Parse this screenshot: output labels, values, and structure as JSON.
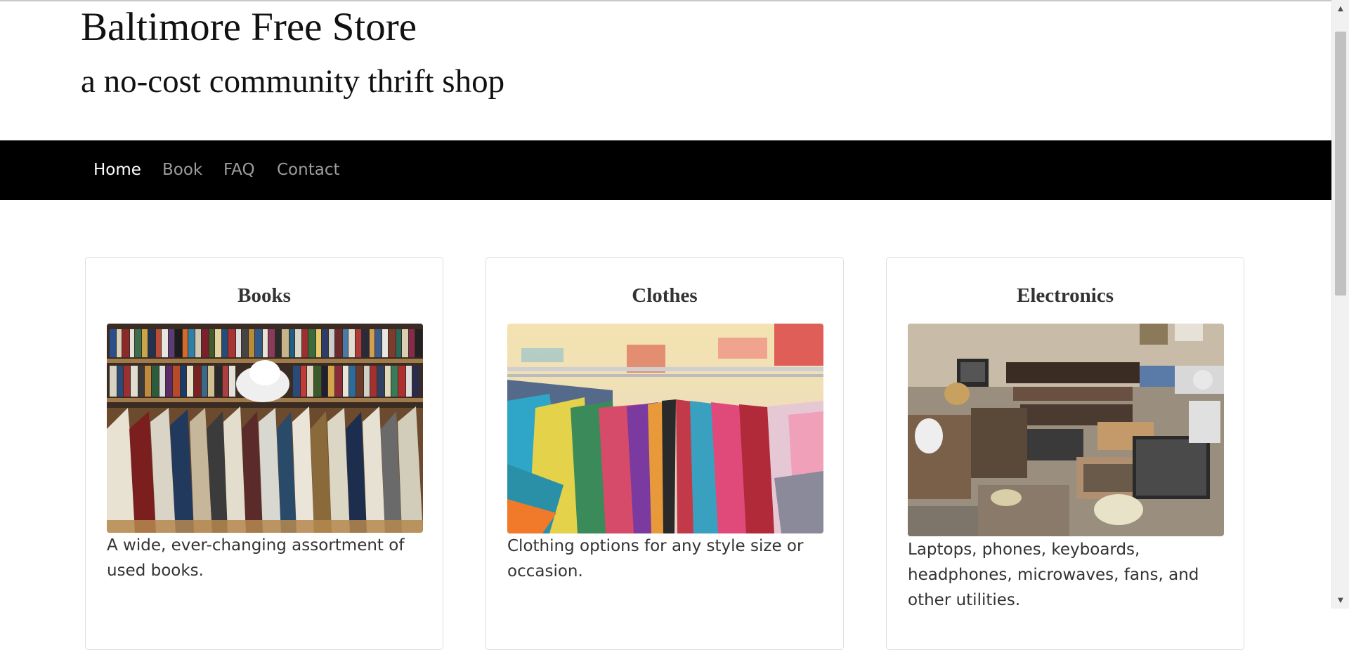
{
  "header": {
    "title": "Baltimore Free Store",
    "subtitle": "a no-cost community thrift shop"
  },
  "nav": {
    "items": [
      {
        "label": "Home",
        "active": true
      },
      {
        "label": "Book",
        "active": false
      },
      {
        "label": "FAQ",
        "active": false
      },
      {
        "label": "Contact",
        "active": false
      }
    ]
  },
  "cards": [
    {
      "title": "Books",
      "image": "photo of bookshelves with used books",
      "description": "A wide, ever-changing assortment of used books."
    },
    {
      "title": "Clothes",
      "image": "photo of colorful clothing racks",
      "description": "Clothing options for any style size or occasion."
    },
    {
      "title": "Electronics",
      "image": "photo of assorted used electronics",
      "description": "Laptops, phones, keyboards, headphones, microwaves, fans, and other utilities."
    }
  ],
  "scrollbar": {
    "up_icon": "chevron-up-icon",
    "down_icon": "chevron-down-icon"
  },
  "colors": {
    "navbar_bg": "#000000",
    "nav_active": "#ffffff",
    "nav_inactive": "#9d9d9d",
    "card_border": "#dedede",
    "text": "#333333"
  }
}
